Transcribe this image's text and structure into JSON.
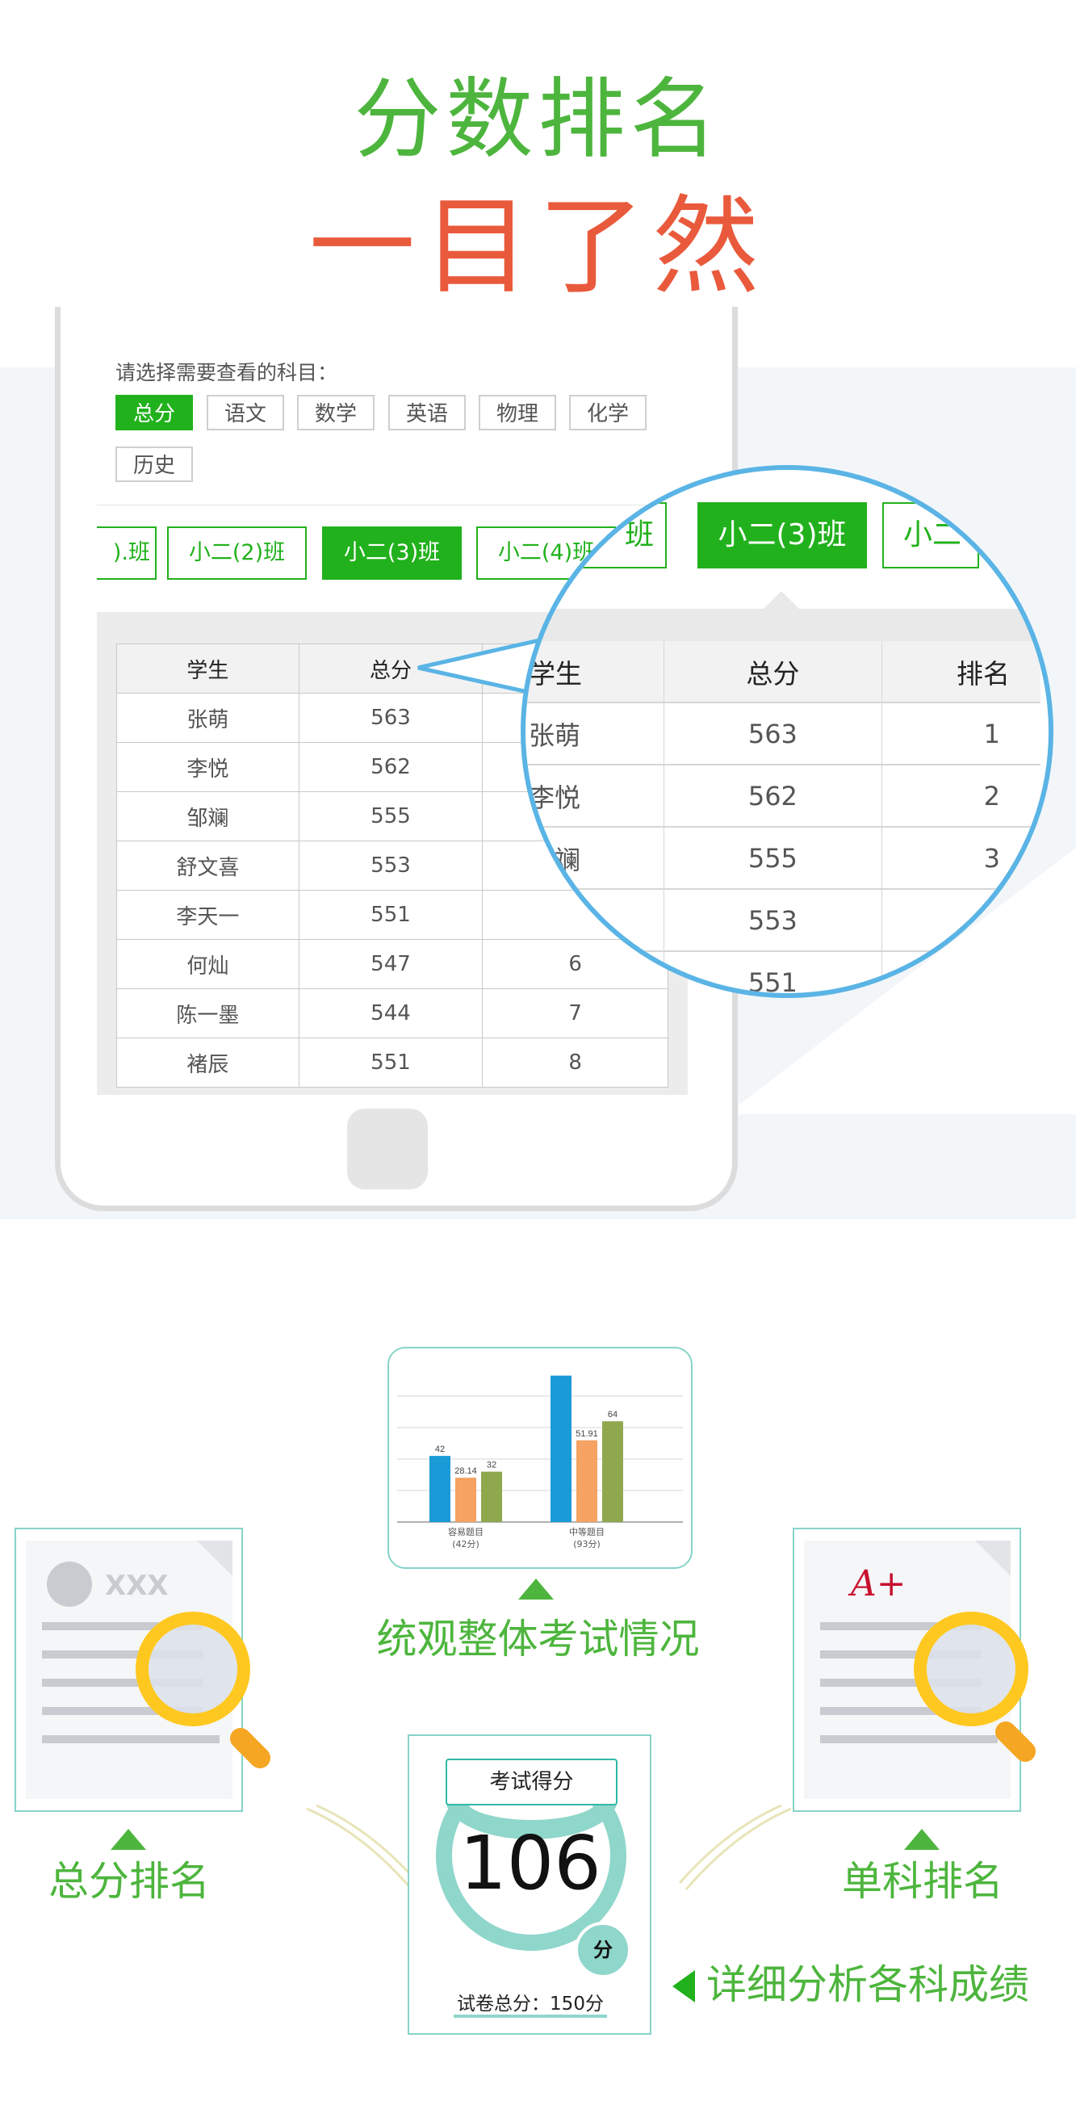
{
  "header": {
    "title_line1": "分数排名",
    "title_line2": "一目了然"
  },
  "phone": {
    "subject_prompt": "请选择需要查看的科目：",
    "subjects": [
      "总分",
      "语文",
      "数学",
      "英语",
      "物理",
      "化学",
      "历史"
    ],
    "selected_subject": "总分",
    "classes": [
      ").班",
      "小二(2)班",
      "小二(3)班",
      "小二(4)班"
    ],
    "selected_class": "小二(3)班",
    "table": {
      "headers": [
        "学生",
        "总分",
        "排名"
      ],
      "rows": [
        {
          "name": "张萌",
          "score": "563",
          "rank": ""
        },
        {
          "name": "李悦",
          "score": "562",
          "rank": ""
        },
        {
          "name": "邹斓",
          "score": "555",
          "rank": ""
        },
        {
          "name": "舒文喜",
          "score": "553",
          "rank": ""
        },
        {
          "name": "李天一",
          "score": "551",
          "rank": ""
        },
        {
          "name": "何灿",
          "score": "547",
          "rank": "6"
        },
        {
          "name": "陈一墨",
          "score": "544",
          "rank": "7"
        },
        {
          "name": "褚辰",
          "score": "551",
          "rank": "8"
        }
      ]
    }
  },
  "zoom": {
    "classes": [
      "班",
      "小二(3)班",
      "小二"
    ],
    "headers": [
      "学生",
      "总分",
      "排名"
    ],
    "rows": [
      {
        "name": "张萌",
        "score": "563",
        "rank": "1"
      },
      {
        "name": "李悦",
        "score": "562",
        "rank": "2"
      },
      {
        "name": "邹斓",
        "score": "555",
        "rank": "3"
      },
      {
        "name": "",
        "score": "553",
        "rank": ""
      },
      {
        "name": "",
        "score": "551",
        "rank": ""
      }
    ]
  },
  "features": {
    "overall": "统观整体考试情况",
    "total_rank": "总分排名",
    "subject_rank": "单科排名",
    "detail": "详细分析各科成绩",
    "doc_placeholder": "XXX",
    "grade_mark": "A+"
  },
  "score_card": {
    "title": "考试得分",
    "score": "106",
    "unit": "分",
    "total_label": "试卷总分：150分"
  },
  "chart_data": {
    "type": "bar",
    "categories": [
      "容易题目(42分)",
      "中等题目(93分)"
    ],
    "category_labels": [
      [
        "容易题目",
        "(42分)"
      ],
      [
        "中等题目",
        "(93分)"
      ]
    ],
    "series": [
      {
        "values": [
          42,
          93
        ],
        "value_labels": [
          "42",
          ""
        ],
        "color": "#1a9ad6"
      },
      {
        "values": [
          28.14,
          51.91
        ],
        "value_labels": [
          "28.14",
          "51.91"
        ],
        "color": "#f5a262"
      },
      {
        "values": [
          32,
          64
        ],
        "value_labels": [
          "32",
          "64"
        ],
        "color": "#8fa84e"
      }
    ],
    "ylim": [
      0,
      100
    ],
    "grid": true
  }
}
